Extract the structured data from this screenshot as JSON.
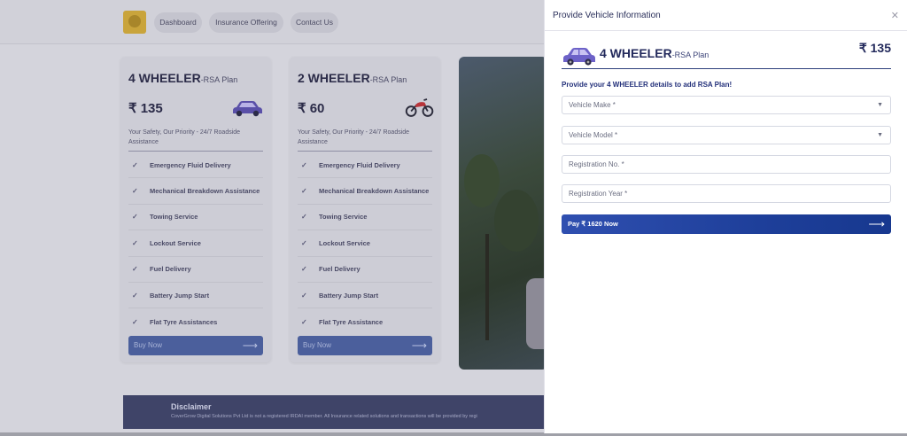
{
  "nav": {
    "items": [
      "Dashboard",
      "Insurance Offering",
      "Contact Us"
    ]
  },
  "plans": [
    {
      "name": "4 WHEELER",
      "suffix": "-RSA Plan",
      "price": "₹ 135",
      "description": "Your Safety, Our Priority - 24/7 Roadside Assistance",
      "icon": "car-icon",
      "features": [
        "Emergency Fluid Delivery",
        "Mechanical Breakdown Assistance",
        "Towing Service",
        "Lockout Service",
        "Fuel Delivery",
        "Battery Jump Start",
        "Flat Tyre Assistances"
      ],
      "buy_label": "Buy Now"
    },
    {
      "name": "2 WHEELER",
      "suffix": "-RSA Plan",
      "price": "₹ 60",
      "description": "Your Safety, Our Priority - 24/7 Roadside Assistance",
      "icon": "motorbike-icon",
      "features": [
        "Emergency Fluid Delivery",
        "Mechanical Breakdown Assistance",
        "Towing Service",
        "Lockout Service",
        "Fuel Delivery",
        "Battery Jump Start",
        "Flat Tyre Assistance"
      ],
      "buy_label": "Buy Now"
    }
  ],
  "disclaimer": {
    "title": "Disclaimer",
    "text": "CoverGrow Digital Solutions Pvt Ltd is not a registered IRDAI member. All Insurance related solutions and transactions will be provided by regi"
  },
  "modal": {
    "title": "Provide Vehicle Information",
    "close_icon": "close-icon",
    "plan_name": "4 WHEELER",
    "plan_suffix": "-RSA Plan",
    "plan_price": "₹ 135",
    "prompt": "Provide your 4 WHEELER details to add RSA Plan!",
    "vehicle_make_placeholder": "Vehicle Make *",
    "vehicle_model_placeholder": "Vehicle Model *",
    "registration_no_placeholder": "Registration No. *",
    "registration_year_placeholder": "Registration Year *",
    "pay_label": "Pay ₹ 1620 Now",
    "arrow": "⟶"
  },
  "colors": {
    "brand_dark": "#232a5c",
    "accent_blue": "#1e3f9a",
    "car_purple": "#6d62c8",
    "bike_red": "#c8383a"
  }
}
